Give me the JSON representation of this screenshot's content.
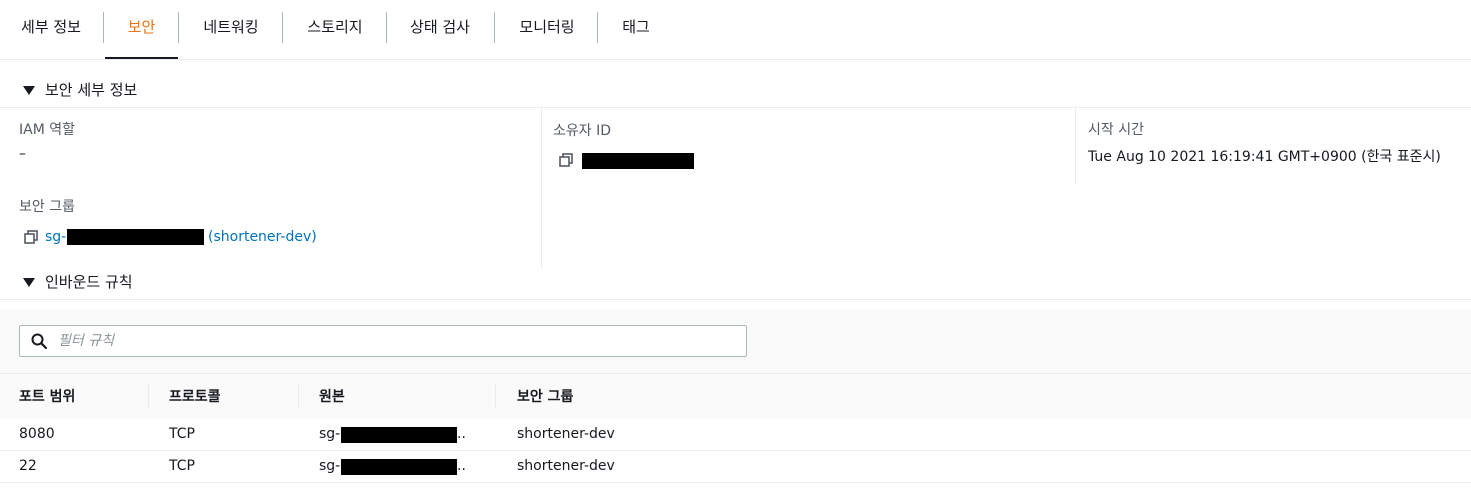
{
  "tabs": [
    {
      "label": "세부 정보",
      "active": false
    },
    {
      "label": "보안",
      "active": true
    },
    {
      "label": "네트워킹",
      "active": false
    },
    {
      "label": "스토리지",
      "active": false
    },
    {
      "label": "상태 검사",
      "active": false
    },
    {
      "label": "모니터링",
      "active": false
    },
    {
      "label": "태그",
      "active": false
    }
  ],
  "security_details": {
    "title": "보안 세부 정보",
    "iam_role_label": "IAM 역할",
    "iam_role_value": "–",
    "owner_id_label": "소유자 ID",
    "launch_time_label": "시작 시간",
    "launch_time_value": "Tue Aug 10 2021 16:19:41 GMT+0900 (한국 표준시)",
    "security_group_label": "보안 그룹",
    "security_group_prefix": "sg-",
    "security_group_name": "(shortener-dev)"
  },
  "inbound_rules": {
    "title": "인바운드 규칙",
    "filter_placeholder": "필터 규칙",
    "columns": [
      "포트 범위",
      "프로토콜",
      "원본",
      "보안 그룹"
    ],
    "rows": [
      {
        "port": "8080",
        "protocol": "TCP",
        "source_prefix": "sg-",
        "source_suffix": "..",
        "security_group": "shortener-dev"
      },
      {
        "port": "22",
        "protocol": "TCP",
        "source_prefix": "sg-",
        "source_suffix": "..",
        "security_group": "shortener-dev"
      }
    ]
  },
  "icons": {
    "copy": "copy-icon",
    "search": "search-icon",
    "caret": "caret-down-icon"
  },
  "colors": {
    "active_tab": "#ec7211",
    "link": "#0073bb",
    "redaction": "#000000"
  }
}
